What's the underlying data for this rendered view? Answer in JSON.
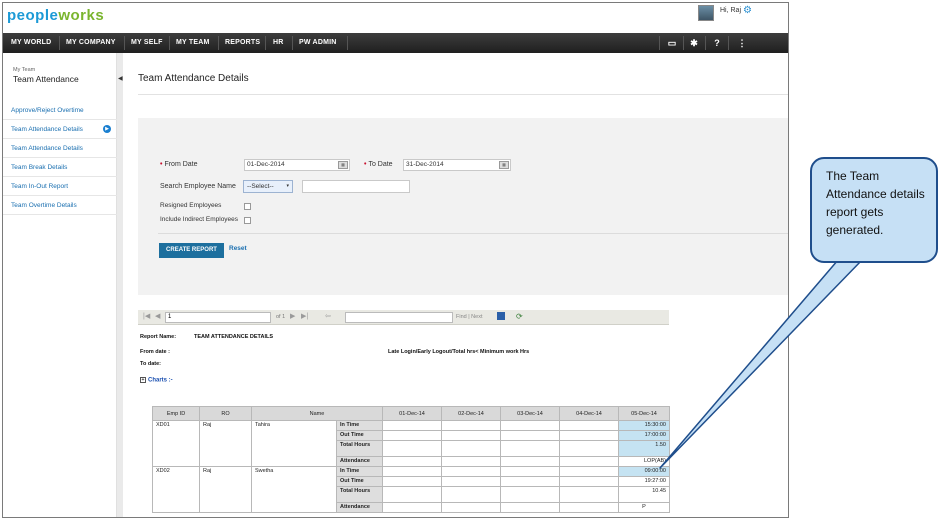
{
  "header": {
    "logo_part1": "people",
    "logo_part2": "works",
    "greeting": "Hi, Raj"
  },
  "nav": {
    "items": [
      "MY WORLD",
      "MY COMPANY",
      "MY SELF",
      "MY TEAM",
      "REPORTS",
      "HR",
      "PW ADMIN"
    ],
    "right_icons": [
      "book-icon",
      "tools-icon",
      "help-icon",
      "org-chart-icon"
    ]
  },
  "sidebar": {
    "crumb": "My Team",
    "title": "Team Attendance",
    "items": [
      "Approve/Reject Overtime",
      "Team Attendance Details",
      "Team Attendance Details",
      "Team Break Details",
      "Team In-Out Report",
      "Team Overtime Details"
    ]
  },
  "page": {
    "title": "Team Attendance Details"
  },
  "filters": {
    "from_date_label": "From Date",
    "from_date_value": "01-Dec-2014",
    "to_date_label": "To Date",
    "to_date_value": "31-Dec-2014",
    "search_label": "Search Employee Name",
    "search_select": "--Select--",
    "resigned_label": "Resigned Employees",
    "indirect_label": "Include Indirect Employees",
    "create_button": "CREATE REPORT",
    "reset_link": "Reset"
  },
  "report_toolbar": {
    "page_value": "1",
    "page_of": "of 1",
    "find_next": "Find | Next"
  },
  "report": {
    "name_label": "Report Name:",
    "name_value": "TEAM ATTENDANCE DETAILS",
    "from_label": "From date :",
    "to_label": "To date:",
    "note": "Late Login/Early Logout/Total hrs< Minimum work Hrs",
    "charts_toggle": "Charts :-",
    "table": {
      "headers": [
        "Emp ID",
        "RO",
        "Name",
        "",
        "01-Dec-14",
        "02-Dec-14",
        "03-Dec-14",
        "04-Dec-14",
        "05-Dec-14"
      ],
      "employees": [
        {
          "emp_id": "XD01",
          "ro": "Raj",
          "name": "Tahira",
          "rows": [
            {
              "metric": "In Time",
              "values": [
                "",
                "",
                "",
                "",
                "15:30:00"
              ]
            },
            {
              "metric": "Out Time",
              "values": [
                "",
                "",
                "",
                "",
                "17:00:00"
              ]
            },
            {
              "metric": "Total Hours",
              "values": [
                "",
                "",
                "",
                "",
                "1.50"
              ]
            },
            {
              "metric": "Attendance",
              "values": [
                "",
                "",
                "",
                "",
                "LOP(AB)"
              ]
            }
          ]
        },
        {
          "emp_id": "XD02",
          "ro": "Raj",
          "name": "Swetha",
          "rows": [
            {
              "metric": "In Time",
              "values": [
                "",
                "",
                "",
                "",
                "09:00:00"
              ]
            },
            {
              "metric": "Out Time",
              "values": [
                "",
                "",
                "",
                "",
                "19:27:00"
              ]
            },
            {
              "metric": "Total Hours",
              "values": [
                "",
                "",
                "",
                "",
                "10.45"
              ]
            },
            {
              "metric": "Attendance",
              "values": [
                "",
                "",
                "",
                "",
                "P"
              ]
            }
          ]
        }
      ]
    }
  },
  "callout": {
    "text": "The Team Attendance details report gets generated."
  },
  "colors": {
    "nav_bg": "#2a2a2a",
    "accent_blue": "#1d6f9e",
    "highlight_cell": "#c5e3f2",
    "callout_fill": "#c6e0f5",
    "callout_border": "#1f4e8c"
  }
}
